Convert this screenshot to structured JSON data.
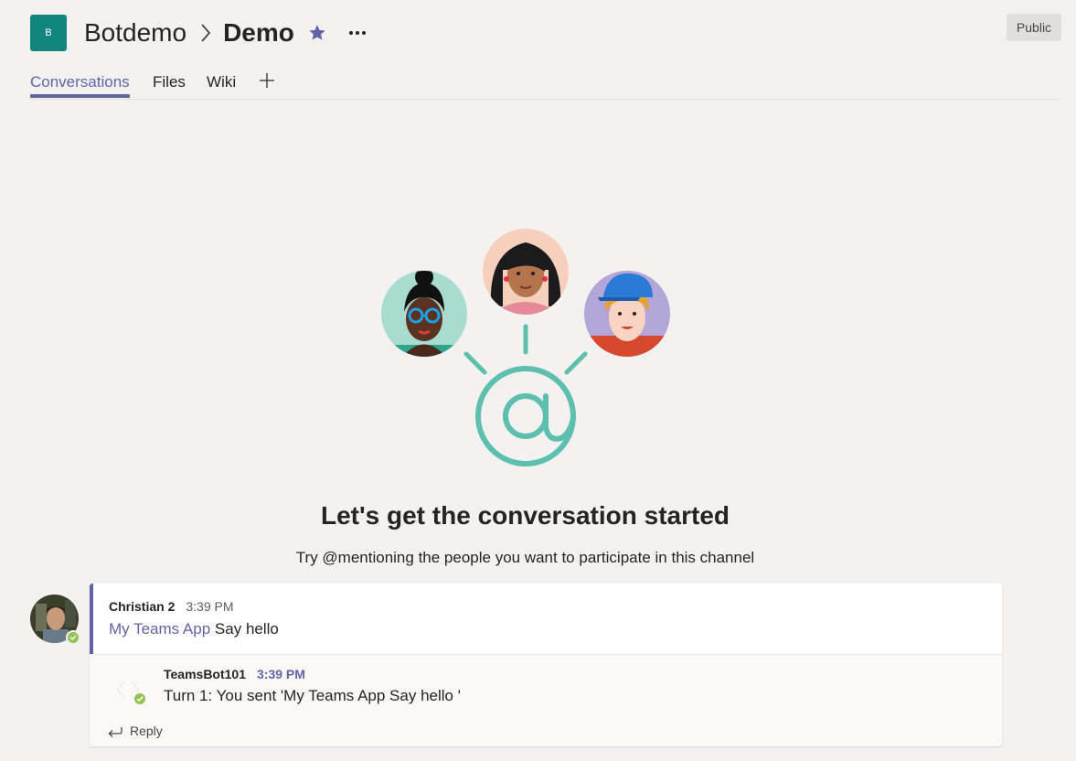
{
  "header": {
    "team_initial": "B",
    "team_name": "Botdemo",
    "channel_name": "Demo",
    "visibility_badge": "Public"
  },
  "tabs": [
    {
      "label": "Conversations",
      "active": true
    },
    {
      "label": "Files",
      "active": false
    },
    {
      "label": "Wiki",
      "active": false
    }
  ],
  "empty_state": {
    "title": "Let's get the conversation started",
    "subtitle": "Try @mentioning the people you want to participate in this channel"
  },
  "message": {
    "author": "Christian 2",
    "time": "3:39 PM",
    "mention": "My Teams App",
    "text": "Say hello"
  },
  "reply": {
    "author": "TeamsBot101",
    "time": "3:39 PM",
    "text": "Turn 1: You sent 'My Teams App Say hello '"
  },
  "reply_button_label": "Reply",
  "colors": {
    "accent": "#6264a7",
    "team_avatar": "#138580",
    "presence_available": "#92c353",
    "illustration_teal": "#5dbfad"
  },
  "icons": [
    "chevron-right-icon",
    "star-icon",
    "more-icon",
    "add-tab-icon",
    "at-mention-icon",
    "reply-arrow-icon",
    "bot-icon",
    "check-icon"
  ]
}
